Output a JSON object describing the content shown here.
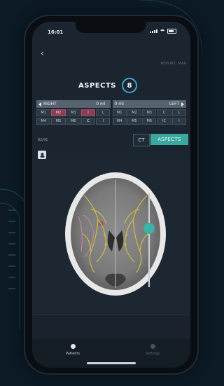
{
  "status_bar": {
    "time": "16:01"
  },
  "nav": {
    "back_glyph": "‹",
    "report_link": "REPORT: MAP"
  },
  "aspects": {
    "title": "ASPECTS",
    "score": "8"
  },
  "regions": {
    "right": {
      "label": "RIGHT",
      "volume": "0 ml",
      "rows": [
        [
          "M1",
          "M2",
          "M3",
          "I",
          "L"
        ],
        [
          "M4",
          "M5",
          "M6",
          "IC",
          "I"
        ]
      ],
      "highlighted": [
        "M2",
        "I"
      ]
    },
    "left": {
      "label": "LEFT",
      "volume": "0 ml",
      "rows": [
        [
          "M1",
          "M2",
          "M3",
          "C",
          "L"
        ],
        [
          "M4",
          "M5",
          "M6",
          "IC",
          "I"
        ]
      ]
    }
  },
  "mode": {
    "row_label": "82/91",
    "ct_label": "CT",
    "aspects_label": "ASPECTS",
    "active": "ASPECTS"
  },
  "slider": {
    "level": 0.38
  },
  "colors": {
    "accent": "#3aa89f",
    "highlight": "#8a3d55",
    "overlay": "#d8c23a"
  },
  "tabbar": {
    "patients_label": "Patients",
    "settings_label": "Settings"
  }
}
